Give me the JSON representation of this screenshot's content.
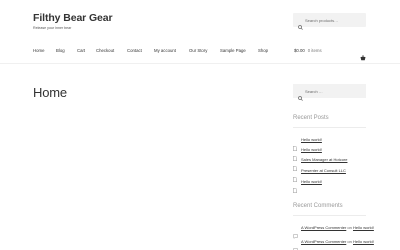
{
  "site": {
    "title": "Filthy Bear Gear",
    "tagline": "Release your inner bear"
  },
  "header_search": {
    "placeholder": "Search products…"
  },
  "nav": {
    "items": [
      "Home",
      "Blog",
      "Cart",
      "Checkout",
      "Contact",
      "My account",
      "Our Story",
      "Sample Page",
      "Shop"
    ]
  },
  "cart": {
    "amount": "$0.00",
    "count": "0 items",
    "icon": "basket-icon"
  },
  "page": {
    "title": "Home"
  },
  "sidebar": {
    "search": {
      "placeholder": "Search …"
    },
    "recent_posts": {
      "title": "Recent Posts",
      "items": [
        "Hello world!",
        "Hello world!",
        "Sales Manager at Hotcore",
        "Presenter at Consult LLC",
        "Hello world!"
      ]
    },
    "recent_comments": {
      "title": "Recent Comments",
      "items": [
        {
          "author": "A WordPress Commenter",
          "on": "on",
          "post": "Hello world!"
        },
        {
          "author": "A WordPress Commenter",
          "on": "on",
          "post": "Hello world!"
        }
      ]
    }
  },
  "colors": {
    "text": "#333333",
    "muted": "#999999",
    "search_bg": "#f2f2f2"
  }
}
